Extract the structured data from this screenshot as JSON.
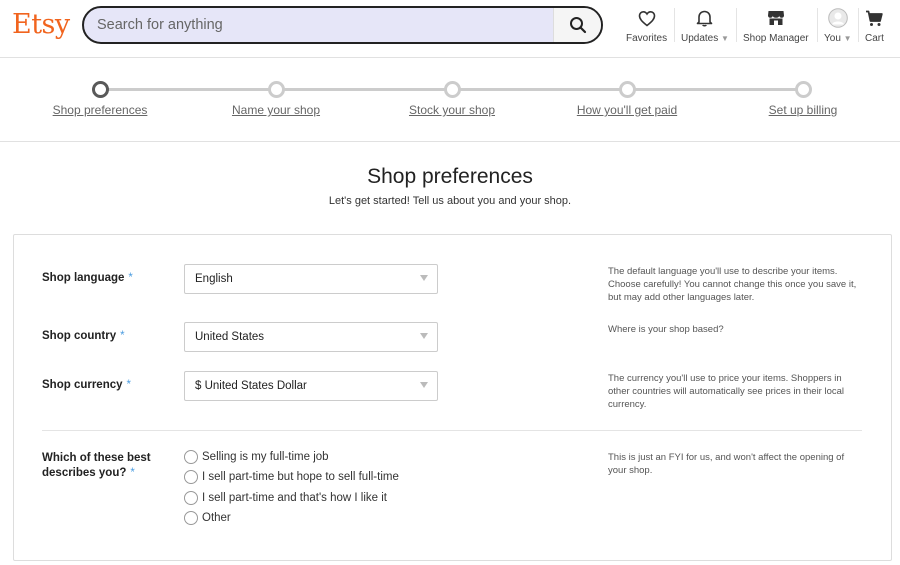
{
  "header": {
    "logo": "Etsy",
    "search_placeholder": "Search for anything",
    "nav": {
      "favorites": "Favorites",
      "updates": "Updates",
      "shop_manager": "Shop Manager",
      "you": "You",
      "cart": "Cart"
    }
  },
  "steps": [
    {
      "label": "Shop preferences",
      "active": true
    },
    {
      "label": "Name your shop",
      "active": false
    },
    {
      "label": "Stock your shop",
      "active": false
    },
    {
      "label": "How you'll get paid",
      "active": false
    },
    {
      "label": "Set up billing",
      "active": false
    }
  ],
  "page": {
    "title": "Shop preferences",
    "subtitle": "Let's get started! Tell us about you and your shop."
  },
  "form": {
    "language": {
      "label": "Shop language",
      "value": "English",
      "help": "The default language you'll use to describe your items. Choose carefully! You cannot change this once you save it, but may add other languages later."
    },
    "country": {
      "label": "Shop country",
      "value": "United States",
      "help": "Where is your shop based?"
    },
    "currency": {
      "label": "Shop currency",
      "value": "$ United States Dollar",
      "help": "The currency you'll use to price your items. Shoppers in other countries will automatically see prices in their local currency."
    },
    "describe": {
      "label_line1": "Which of these best",
      "label_line2": "describes you?",
      "help": "This is just an FYI for us, and won't affect the opening of your shop.",
      "options": [
        "Selling is my full-time job",
        "I sell part-time but hope to sell full-time",
        "I sell part-time and that's how I like it",
        "Other"
      ]
    },
    "required_marker": "*"
  },
  "colors": {
    "brand": "#f1641e",
    "required": "#4d9de0"
  }
}
